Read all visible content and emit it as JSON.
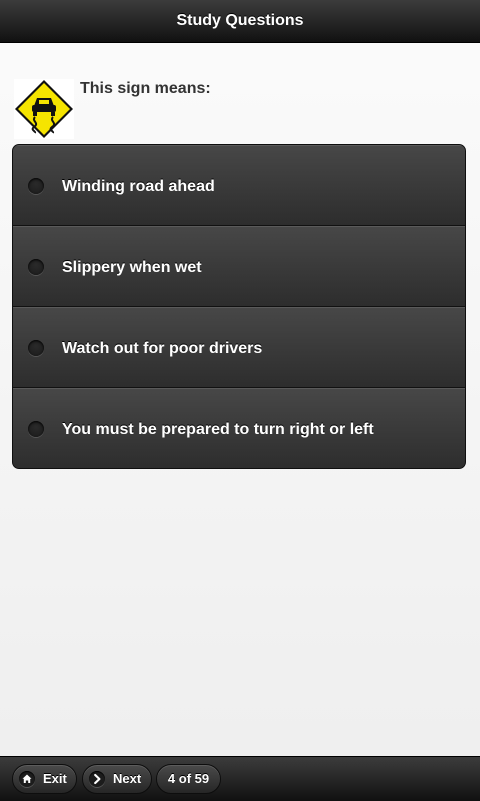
{
  "header": {
    "title": "Study Questions"
  },
  "question": {
    "prompt": "This sign means:",
    "sign_icon": "slippery-road-sign-icon"
  },
  "answers": [
    {
      "label": "Winding road ahead"
    },
    {
      "label": "Slippery when wet"
    },
    {
      "label": "Watch out for poor drivers"
    },
    {
      "label": "You must be prepared to turn right or left"
    }
  ],
  "footer": {
    "exit_label": "Exit",
    "next_label": "Next",
    "progress_label": "4 of 59",
    "exit_icon": "home-icon",
    "next_icon": "chevron-right-icon"
  },
  "colors": {
    "sign_yellow": "#f5e400",
    "bar_dark": "#1b1b1b"
  }
}
